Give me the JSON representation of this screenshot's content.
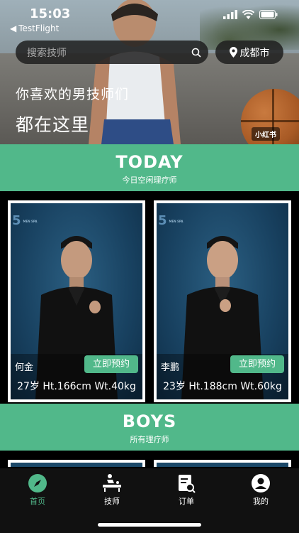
{
  "status_bar": {
    "time": "15:03",
    "back_app": "TestFlight"
  },
  "search": {
    "placeholder": "搜索技师"
  },
  "location": {
    "city": "成都市"
  },
  "hero": {
    "line1": "你喜欢的男技师们",
    "line2": "都在这里",
    "badge": "小红书"
  },
  "sections": [
    {
      "title": "TODAY",
      "subtitle": "今日空闲理疗师"
    },
    {
      "title": "BOYS",
      "subtitle": "所有理疗师"
    }
  ],
  "therapists": [
    {
      "name": "何金",
      "stats": "27岁 Ht.166cm Wt.40kg",
      "book_label": "立即预约"
    },
    {
      "name": "李鹏",
      "stats": "23岁 Ht.188cm Wt.60kg",
      "book_label": "立即预约"
    }
  ],
  "tabbar": {
    "items": [
      {
        "label": "首页",
        "icon": "compass-icon",
        "active": true
      },
      {
        "label": "技师",
        "icon": "massage-icon",
        "active": false
      },
      {
        "label": "订单",
        "icon": "order-icon",
        "active": false
      },
      {
        "label": "我的",
        "icon": "user-icon",
        "active": false
      }
    ]
  },
  "colors": {
    "accent": "#51b88a",
    "card_bg": "#1b4868",
    "tab_bg": "#111111"
  }
}
